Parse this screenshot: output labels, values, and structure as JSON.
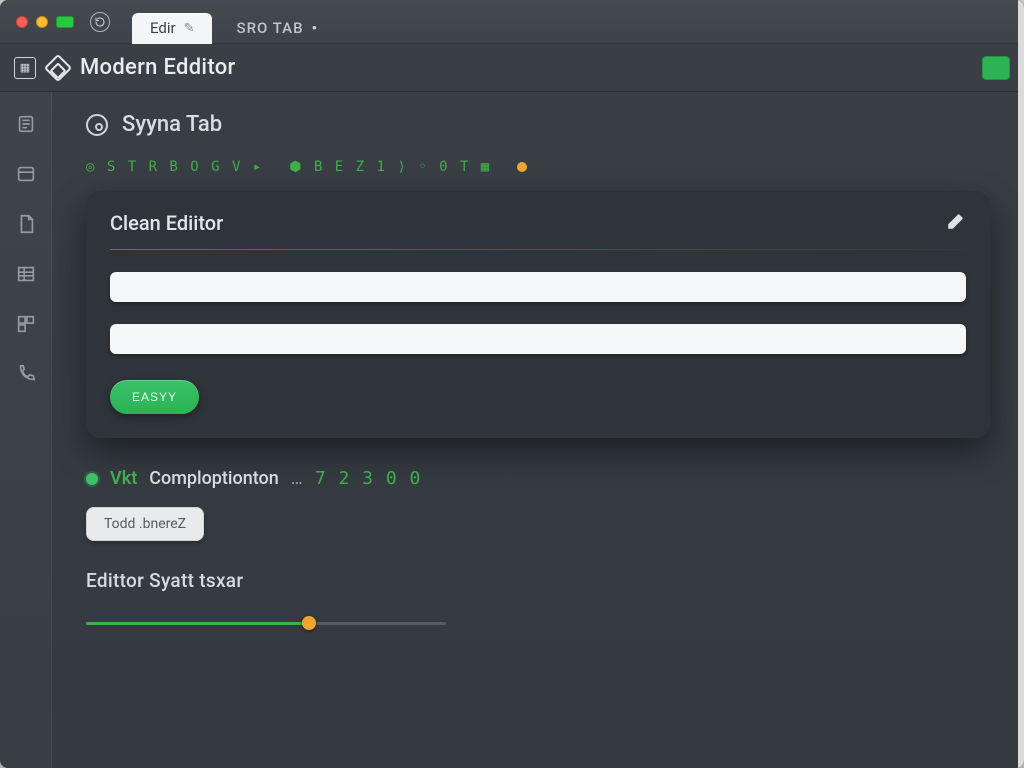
{
  "titlebar": {
    "tabs": [
      {
        "label": "Edir",
        "active": true
      },
      {
        "label": "SRO TAB",
        "modified": "•",
        "active": false
      }
    ]
  },
  "header": {
    "title": "Modern Edditor"
  },
  "sidebar": {
    "items": [
      "files-icon",
      "layout-icon",
      "page-icon",
      "table-icon",
      "widget-icon",
      "phone-icon"
    ]
  },
  "section": {
    "title": "Syyna Tab",
    "code_segment_a": "◎ S T R B O G V ▸",
    "code_segment_b": "⬢ B E Z 1 ⟩ ◦ 0 T ▦"
  },
  "card": {
    "title": "Clean Ediitor",
    "button_label": "EASYY"
  },
  "completion": {
    "prefix": "Vkt",
    "label": "Comploptionton",
    "ellipsis": "…",
    "value": "7 2 3 0 0"
  },
  "chip": {
    "label": "Todd .bnereZ"
  },
  "subheading": "Edittor  Syatt tsxar",
  "slider": {
    "percent": 62
  }
}
